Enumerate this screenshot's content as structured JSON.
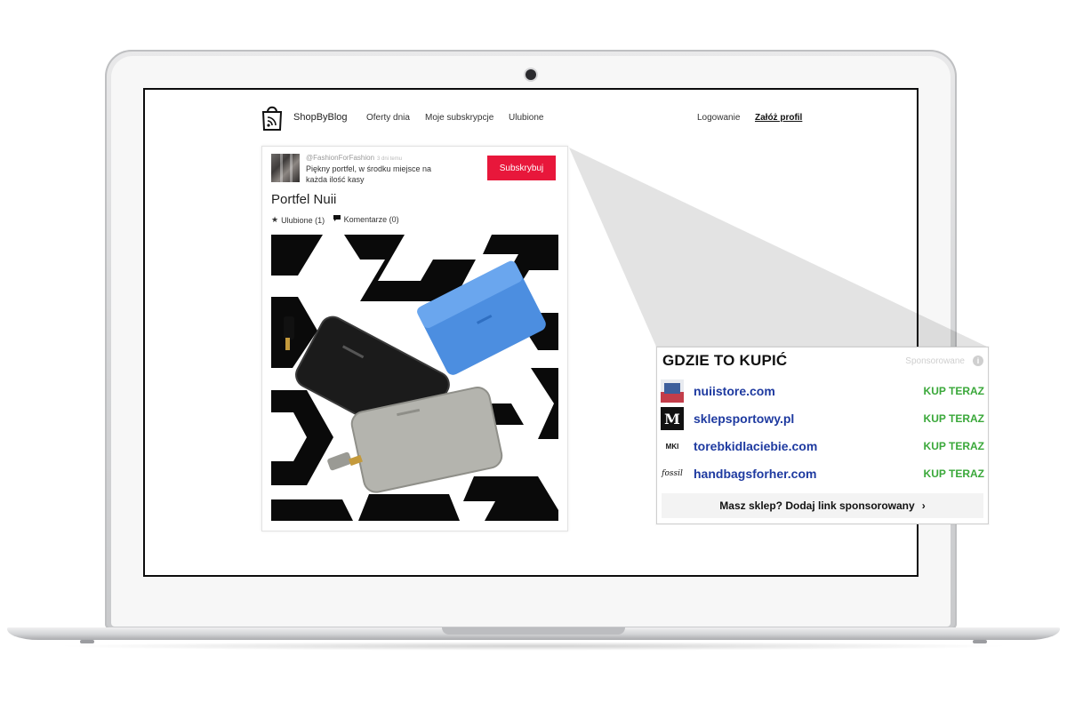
{
  "site": {
    "logo_text": "ShopByBlog",
    "nav": [
      "Oferty dnia",
      "Moje subskrypcje",
      "Ulubione"
    ],
    "login_label": "Logowanie",
    "register_label": "Załóż profil"
  },
  "post": {
    "author_handle": "@FashionForFashion",
    "time_text": "3 dni temu",
    "description": "Piękny portfel, w środku miejsce na każda ilość kasy",
    "subscribe_label": "Subskrybuj",
    "title": "Portfel Nuii",
    "likes_label": "Ulubione (1)",
    "comments_label": "Komentarze (0)"
  },
  "buy_panel": {
    "title": "GDZIE TO KUPIĆ",
    "sponsored_label": "Sponsorowane",
    "info_glyph": "i",
    "shops": [
      {
        "name": "nuiistore.com",
        "logo": "nuii-logo",
        "cta": "KUP TERAZ"
      },
      {
        "name": "sklepsportowy.pl",
        "logo": "M",
        "cta": "KUP TERAZ"
      },
      {
        "name": "torebkidlaciebie.com",
        "logo": "MKI",
        "cta": "KUP TERAZ"
      },
      {
        "name": "handbagsforher.com",
        "logo": "fossil",
        "cta": "KUP TERAZ"
      }
    ],
    "add_link_label": "Masz sklep? Dodaj link sponsorowany",
    "chevron_glyph": "›"
  },
  "icons": {
    "star": "★",
    "comment": "💬"
  },
  "colors": {
    "subscribe": "#e8173b",
    "shop_link": "#1e3aa0",
    "buy_now": "#3aa83a"
  }
}
